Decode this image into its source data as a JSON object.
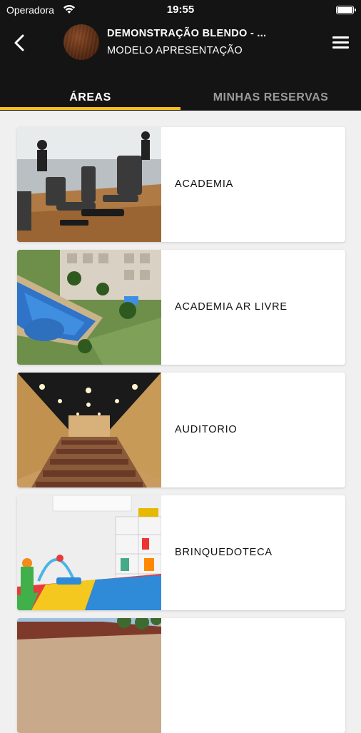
{
  "status_bar": {
    "carrier": "Operadora",
    "time": "19:55"
  },
  "header": {
    "title": "DEMONSTRAÇÃO BLENDO - ...",
    "subtitle": "MODELO APRESENTAÇÃO",
    "back_icon": "chevron-left-icon",
    "menu_icon": "hamburger-menu-icon"
  },
  "tabs": [
    {
      "label": "ÁREAS",
      "active": true
    },
    {
      "label": "MINHAS RESERVAS",
      "active": false
    }
  ],
  "accent_color": "#f2c01c",
  "areas": [
    {
      "label": "ACADEMIA",
      "image": "gym-photo"
    },
    {
      "label": "ACADEMIA AR LIVRE",
      "image": "pool-aerial-photo"
    },
    {
      "label": "AUDITORIO",
      "image": "auditorium-photo"
    },
    {
      "label": "BRINQUEDOTECA",
      "image": "playroom-photo"
    },
    {
      "label": "",
      "image": "building-photo"
    }
  ]
}
